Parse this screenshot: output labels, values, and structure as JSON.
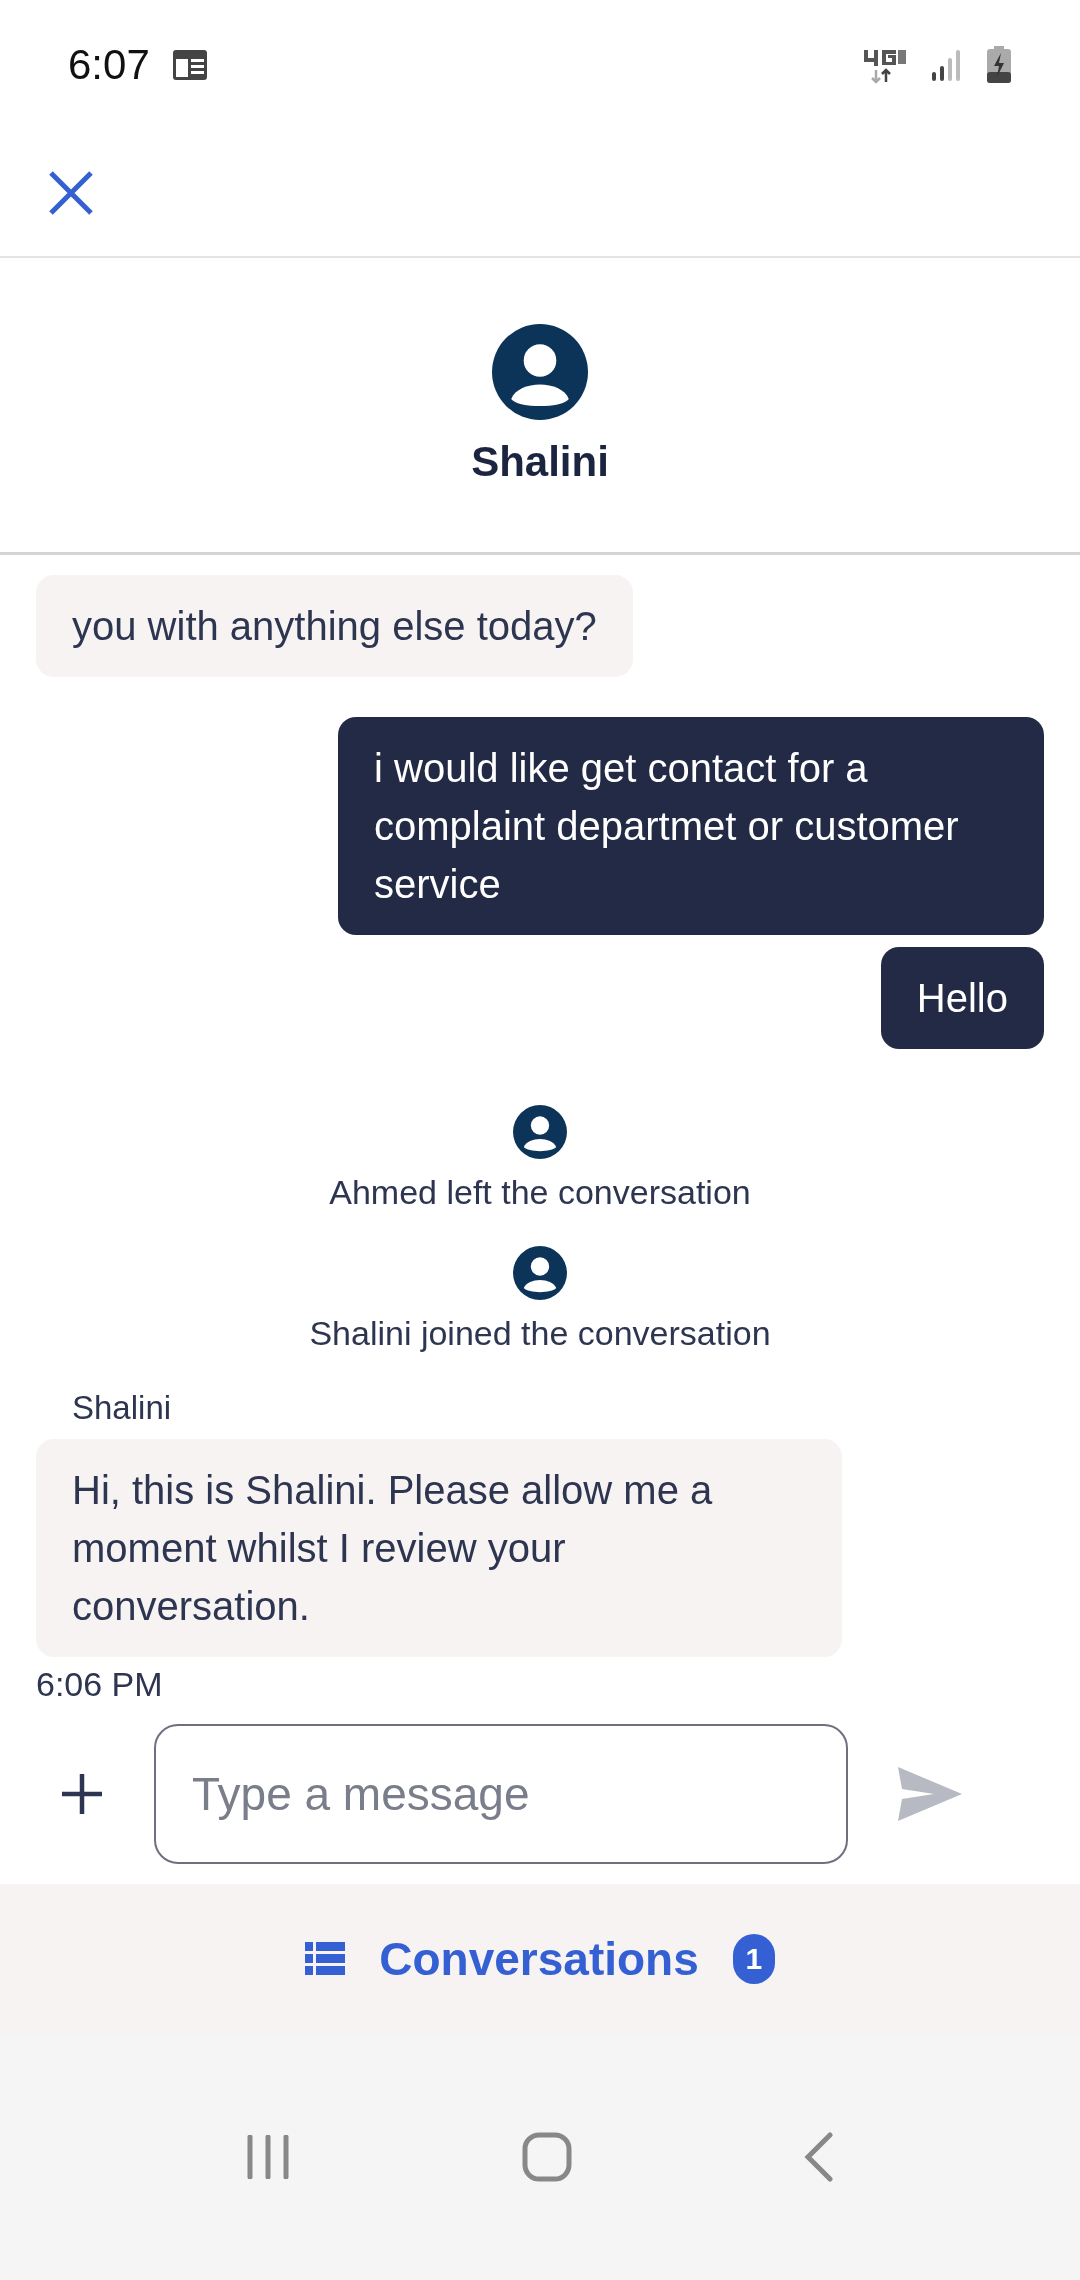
{
  "status_bar": {
    "time": "6:07"
  },
  "header": {
    "agent_name": "Shalini"
  },
  "messages": [
    {
      "kind": "incoming",
      "text": "you with anything else today?"
    },
    {
      "kind": "outgoing",
      "text": "i would like get contact for a complaint departmet or customer service"
    },
    {
      "kind": "outgoing",
      "text": "Hello"
    },
    {
      "kind": "system",
      "text": "Ahmed left the conversation"
    },
    {
      "kind": "system",
      "text": "Shalini joined the conversation"
    },
    {
      "kind": "incoming",
      "sender": "Shalini",
      "text": "Hi, this is Shalini. Please allow me a moment whilst I review your conversation.",
      "time": "6:06 PM"
    }
  ],
  "composer": {
    "placeholder": "Type a message"
  },
  "bottom_bar": {
    "label": "Conversations",
    "badge": "1"
  }
}
